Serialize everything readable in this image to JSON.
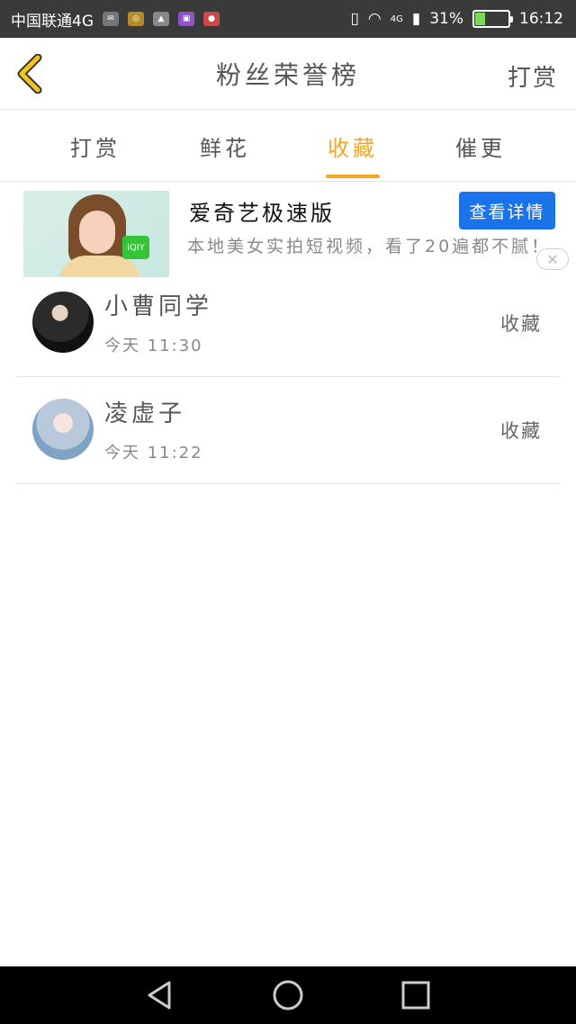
{
  "status_bar": {
    "carrier": "中国联通4G",
    "net_small": "4G",
    "battery": "31%",
    "battery_level": 0.31,
    "time": "16:12"
  },
  "header": {
    "title": "粉丝荣誉榜",
    "action": "打赏"
  },
  "tabs": [
    {
      "label": "打赏",
      "active": false
    },
    {
      "label": "鲜花",
      "active": false
    },
    {
      "label": "收藏",
      "active": true
    },
    {
      "label": "催更",
      "active": false
    }
  ],
  "ad": {
    "title": "爱奇艺极速版",
    "description": "本地美女实拍短视频，看了20遍都不腻！",
    "button": "查看详情",
    "logo_text": "iQIY"
  },
  "list": [
    {
      "name": "小曹同学",
      "time": "今天 11:30",
      "action": "收藏"
    },
    {
      "name": "凌虚子",
      "time": "今天 11:22",
      "action": "收藏"
    }
  ],
  "colors": {
    "accent": "#f5a623",
    "ad_button": "#1a73e8",
    "status_bar": "#3a3a3a"
  }
}
